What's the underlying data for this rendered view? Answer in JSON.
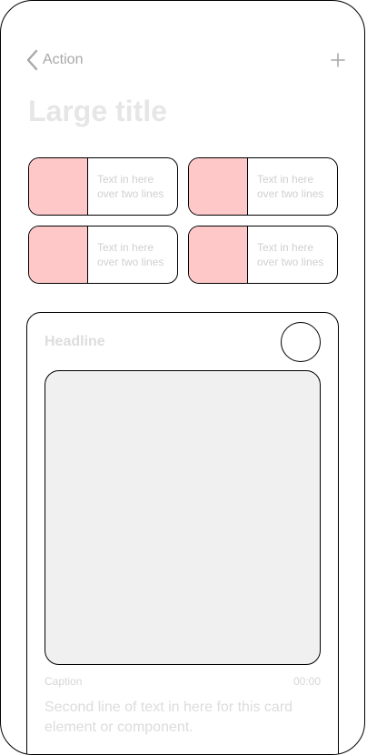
{
  "nav": {
    "back_label": "Action",
    "back_icon": "chevron-left-icon",
    "add_icon": "plus-icon"
  },
  "title": "Large title",
  "tiles": [
    {
      "text_line1": "Text in here",
      "text_line2": "over two lines"
    },
    {
      "text_line1": "Text in here",
      "text_line2": "over two lines"
    },
    {
      "text_line1": "Text in here",
      "text_line2": "over two lines"
    },
    {
      "text_line1": "Text in here",
      "text_line2": "over two lines"
    }
  ],
  "card": {
    "headline": "Headline",
    "caption": "Caption",
    "time": "00:00",
    "body": "Second line of text in here for this card element or component."
  },
  "colors": {
    "tile_swatch": "#ffc8c8",
    "media_fill": "#f0f0f0",
    "placeholder_text": "#d0d0d0",
    "outline": "#000000"
  }
}
